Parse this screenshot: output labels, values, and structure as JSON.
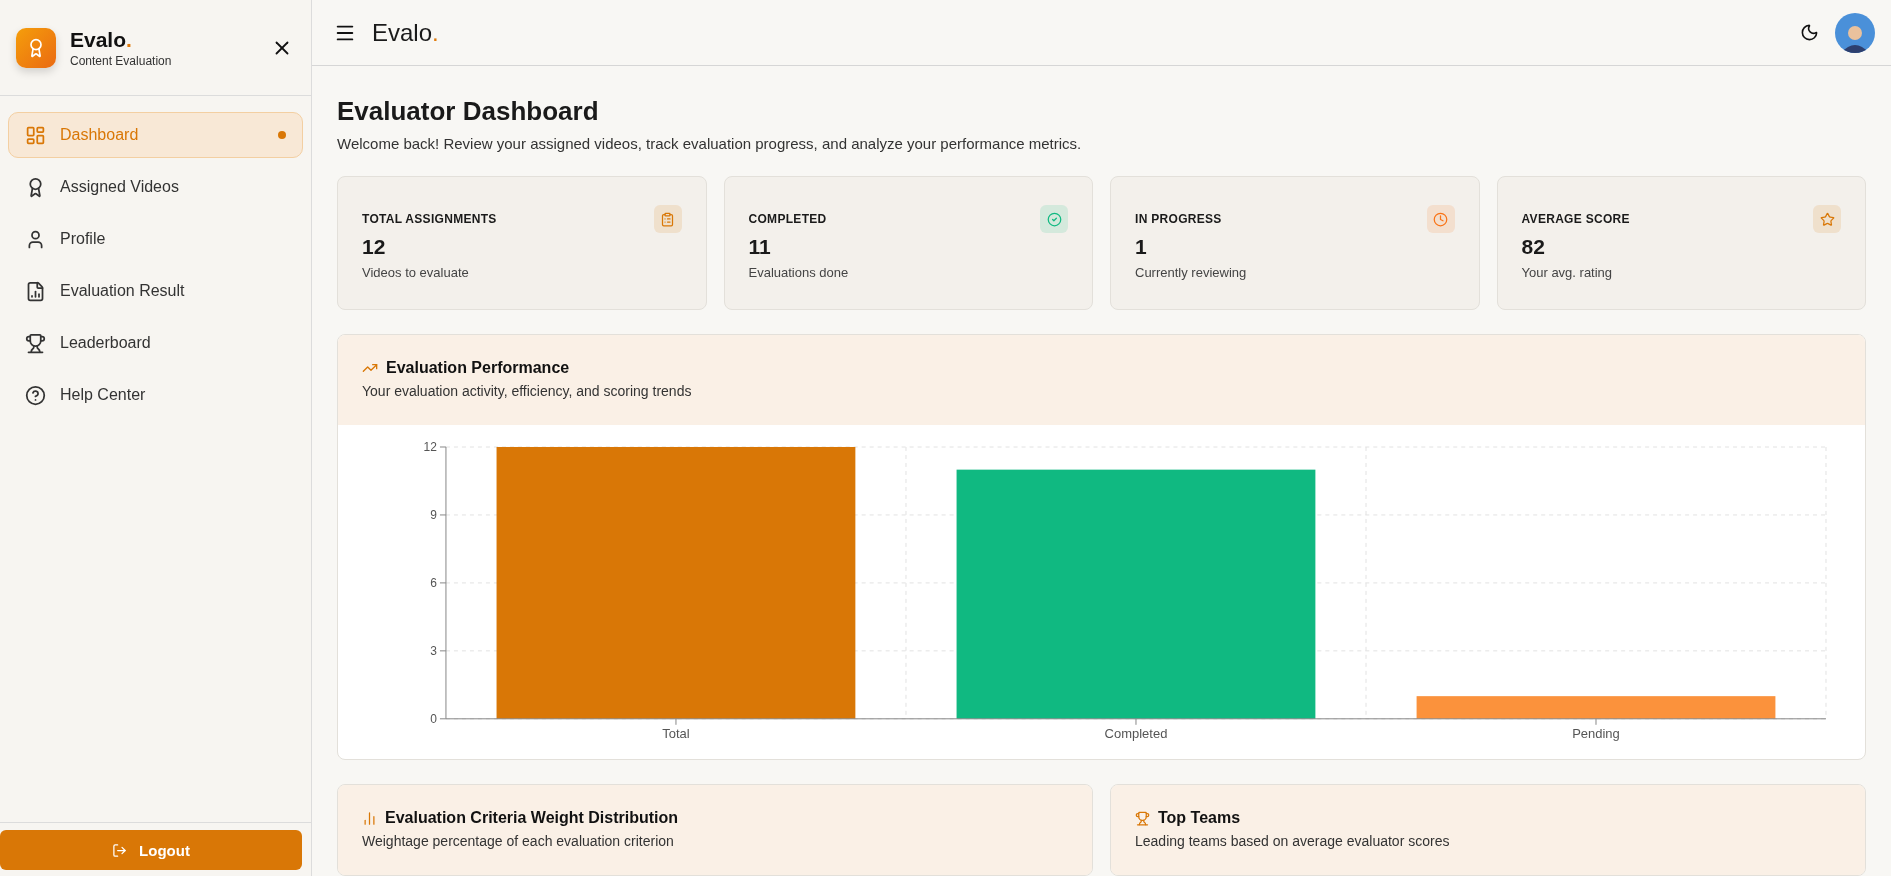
{
  "sidebar": {
    "brand": "Evalo",
    "brand_dot": ".",
    "tagline": "Content Evaluation",
    "items": [
      {
        "label": "Dashboard",
        "selected": true
      },
      {
        "label": "Assigned Videos",
        "selected": false
      },
      {
        "label": "Profile",
        "selected": false
      },
      {
        "label": "Evaluation Result",
        "selected": false
      },
      {
        "label": "Leaderboard",
        "selected": false
      },
      {
        "label": "Help Center",
        "selected": false
      }
    ],
    "logout": "Logout"
  },
  "header": {
    "brand": "Evalo",
    "brand_dot": "."
  },
  "page": {
    "title": "Evaluator Dashboard",
    "subtitle": "Welcome back! Review your assigned videos, track evaluation progress, and analyze your performance metrics."
  },
  "stats": [
    {
      "label": "TOTAL ASSIGNMENTS",
      "value": "12",
      "note": "Videos to evaluate",
      "color": "#d97706"
    },
    {
      "label": "COMPLETED",
      "value": "11",
      "note": "Evaluations done",
      "color": "#10b981"
    },
    {
      "label": "IN PROGRESS",
      "value": "1",
      "note": "Currently reviewing",
      "color": "#f97316"
    },
    {
      "label": "AVERAGE SCORE",
      "value": "82",
      "note": "Your avg. rating",
      "color": "#d97706"
    }
  ],
  "performance": {
    "title": "Evaluation Performance",
    "subtitle": "Your evaluation activity, efficiency, and scoring trends",
    "chart_data": {
      "type": "bar",
      "categories": [
        "Total",
        "Completed",
        "Pending"
      ],
      "values": [
        12,
        11,
        1
      ],
      "colors": [
        "#d97706",
        "#10b981",
        "#fb923c"
      ],
      "ylim": [
        0,
        12
      ],
      "grid": true,
      "yticks": [
        0,
        3,
        6,
        9,
        12
      ]
    }
  },
  "panels": [
    {
      "title": "Evaluation Criteria Weight Distribution",
      "subtitle": "Weightage percentage of each evaluation criterion"
    },
    {
      "title": "Top Teams",
      "subtitle": "Leading teams based on average evaluator scores"
    }
  ]
}
